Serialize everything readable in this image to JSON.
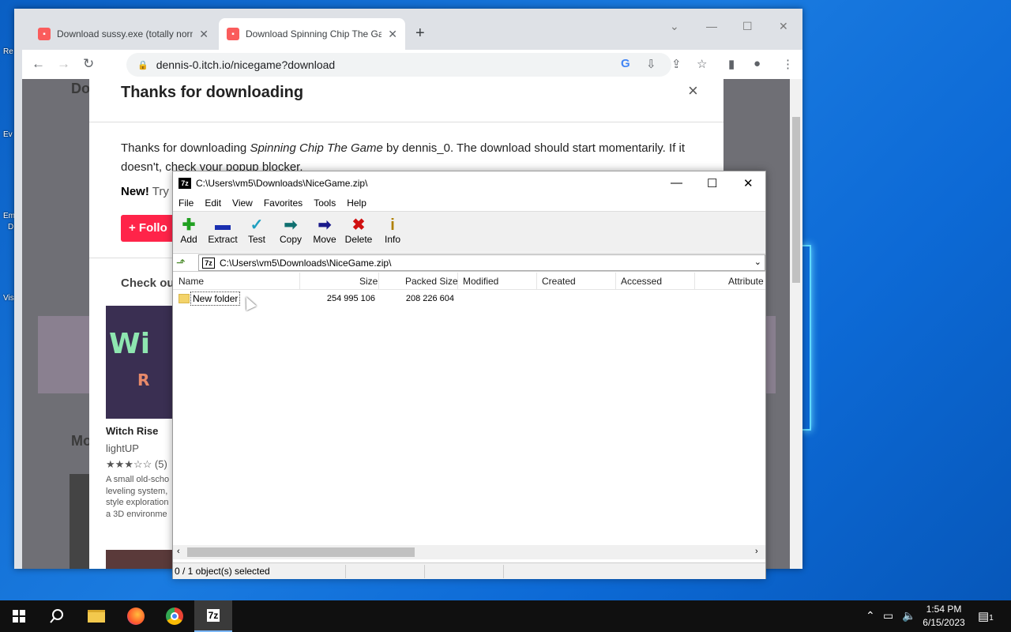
{
  "desktop": {
    "labels": [
      "Re",
      "Ev",
      "Em",
      "D",
      "Vis"
    ]
  },
  "browser": {
    "tabs": [
      {
        "title": "Download sussy.exe (totally norm",
        "active": false
      },
      {
        "title": "Download Spinning Chip The Ga",
        "active": true
      }
    ],
    "url": "dennis-0.itch.io/nicegame?download"
  },
  "page": {
    "bg_headings": [
      "Do",
      "Check ou",
      "Mo"
    ],
    "modal": {
      "title": "Thanks for downloading",
      "message_pre": "Thanks for downloading ",
      "message_game": "Spinning Chip The Game",
      "message_post": " by dennis_0. The download should start momentarily. If it doesn't, check your popup blocker.",
      "new_label": "New!",
      "new_rest": " Try",
      "follow_label": "+ Follo",
      "check_label": "Check ou",
      "game": {
        "title": "Witch Rise",
        "author": "lightUP",
        "rating_count": "(5)",
        "rating": 3.5,
        "desc_lines": [
          "A small old-scho",
          "leveling system,",
          "style exploration",
          "a 3D environme"
        ]
      }
    }
  },
  "sevenzip": {
    "title": "C:\\Users\\vm5\\Downloads\\NiceGame.zip\\",
    "menu": [
      "File",
      "Edit",
      "View",
      "Favorites",
      "Tools",
      "Help"
    ],
    "toolbar": [
      "Add",
      "Extract",
      "Test",
      "Copy",
      "Move",
      "Delete",
      "Info"
    ],
    "path": "C:\\Users\\vm5\\Downloads\\NiceGame.zip\\",
    "columns": [
      "Name",
      "Size",
      "Packed Size",
      "Modified",
      "Created",
      "Accessed",
      "Attribute"
    ],
    "rows": [
      {
        "name": "New folder",
        "size": "254 995 106",
        "packed": "208 226 604"
      }
    ],
    "status": "0 / 1 object(s) selected"
  },
  "taskbar": {
    "time": "1:54 PM",
    "date": "6/15/2023",
    "notification_count": "1"
  }
}
